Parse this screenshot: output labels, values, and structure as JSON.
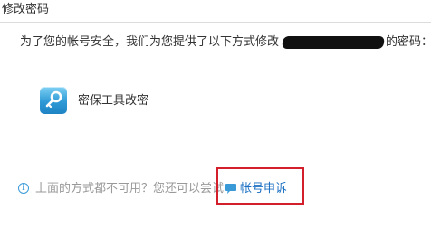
{
  "header": {
    "title": "修改密码"
  },
  "intro": {
    "before": "为了您的帐号安全，我们为您提供了以下方式修改",
    "after": "的密码："
  },
  "options": [
    {
      "label": "密保工具改密",
      "icon": "key-icon"
    }
  ],
  "hint": {
    "icon": "info-icon",
    "text": "上面的方式都不可用？您还可以尝试"
  },
  "appeal": {
    "icon": "chat-bubble-icon",
    "label": "帐号申诉"
  },
  "colors": {
    "highlight_border": "#d21f2b",
    "link": "#1a6fc2",
    "icon_blue": "#2e9ad6"
  }
}
